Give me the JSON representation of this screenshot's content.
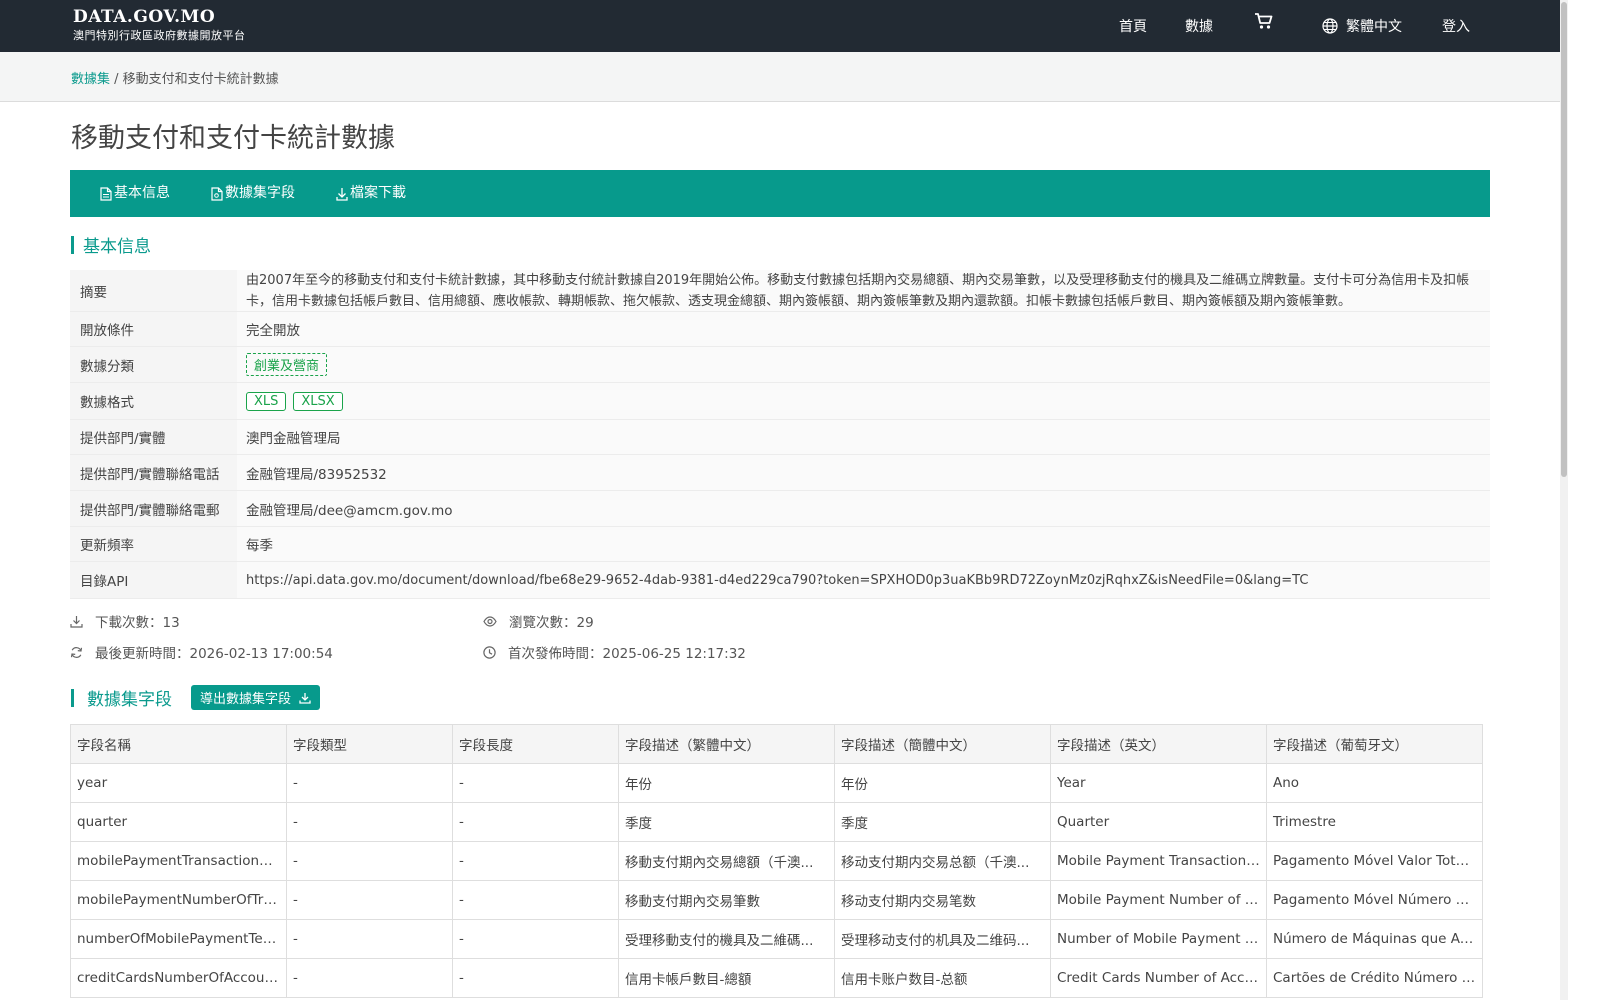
{
  "header": {
    "brand_title": "DATA.GOV.MO",
    "brand_subtitle": "澳門特別行政區政府數據開放平台",
    "nav": {
      "home": "首頁",
      "data": "數據",
      "language": "繁體中文",
      "login": "登入"
    },
    "icons": [
      "cart-icon",
      "globe-icon"
    ]
  },
  "breadcrumb": {
    "root": "數據集",
    "separator": " / ",
    "current": "移動支付和支付卡統計數據"
  },
  "page_title": "移動支付和支付卡統計數據",
  "tabs": {
    "basic_info": "基本信息",
    "fields": "數據集字段",
    "download": "檔案下載"
  },
  "basic_info": {
    "heading": "基本信息",
    "rows": {
      "abstract": {
        "label": "摘要",
        "value": "由2007年至今的移動支付和支付卡統計數據，其中移動支付統計數據自2019年開始公佈。移動支付數據包括期內交易總額、期內交易筆數，以及受理移動支付的機具及二維碼立牌數量。支付卡可分為信用卡及扣帳卡，信用卡數據包括帳戶數目、信用總額、應收帳款、轉期帳款、拖欠帳款、透支現金總額、期內簽帳額、期內簽帳筆數及期內還款額。扣帳卡數據包括帳戶數目、期內簽帳額及期內簽帳筆數。"
      },
      "open_condition": {
        "label": "開放條件",
        "value": "完全開放"
      },
      "category": {
        "label": "數據分類",
        "value": "創業及營商"
      },
      "format": {
        "label": "數據格式",
        "values": [
          "XLS",
          "XLSX"
        ]
      },
      "provider": {
        "label": "提供部門/實體",
        "value": "澳門金融管理局"
      },
      "phone": {
        "label": "提供部門/實體聯絡電話",
        "value": "金融管理局/83952532"
      },
      "email": {
        "label": "提供部門/實體聯絡電郵",
        "value": "金融管理局/dee@amcm.gov.mo"
      },
      "frequency": {
        "label": "更新頻率",
        "value": "每季"
      },
      "api": {
        "label": "目錄API",
        "value": "https://api.data.gov.mo/document/download/fbe68e29-9652-4dab-9381-d4ed229ca790?token=SPXHOD0p3uaKBb9RD72ZoynMz0zjRqhxZ&isNeedFile=0&lang=TC"
      }
    }
  },
  "stats": {
    "downloads": "下載次數：13",
    "views": "瀏覽次數：29",
    "last_updated": "最後更新時間：2026-02-13 17:00:54",
    "first_published": "首次發佈時間：2025-06-25 12:17:32"
  },
  "fields_section": {
    "heading": "數據集字段",
    "export_button": "導出數據集字段",
    "columns": [
      "字段名稱",
      "字段類型",
      "字段長度",
      "字段描述（繁體中文）",
      "字段描述（簡體中文）",
      "字段描述（英文）",
      "字段描述（葡萄牙文）"
    ],
    "rows": [
      [
        "year",
        "-",
        "-",
        "年份",
        "年份",
        "Year",
        "Ano"
      ],
      [
        "quarter",
        "-",
        "-",
        "季度",
        "季度",
        "Quarter",
        "Trimestre"
      ],
      [
        "mobilePaymentTransactionVal...",
        "-",
        "-",
        "移動支付期內交易總額（千澳...",
        "移动支付期内交易总额（千澳...",
        "Mobile Payment Transaction V...",
        "Pagamento Móvel Valor Total d..."
      ],
      [
        "mobilePaymentNumberOfTran...",
        "-",
        "-",
        "移動支付期內交易筆數",
        "移动支付期内交易笔数",
        "Mobile Payment Number of Tr...",
        "Pagamento Móvel Número de ..."
      ],
      [
        "numberOfMobilePaymentTermi...",
        "-",
        "-",
        "受理移動支付的機具及二維碼...",
        "受理移动支付的机具及二维码...",
        "Number of Mobile Payment Ter...",
        "Número de Máquinas que Acei..."
      ],
      [
        "creditCardsNumberOfAccount...",
        "-",
        "-",
        "信用卡帳戶數目-總額",
        "信用卡账户数目-总额",
        "Credit Cards Number of Accou...",
        "Cartões de Crédito Número de..."
      ]
    ]
  }
}
